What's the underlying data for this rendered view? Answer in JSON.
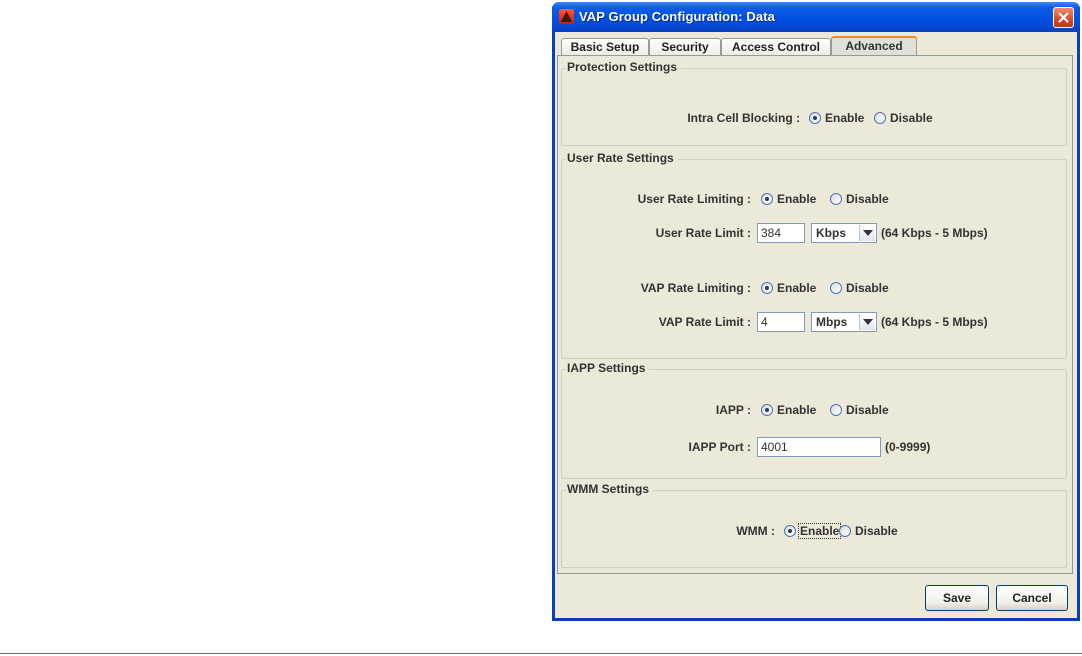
{
  "window": {
    "title": "VAP Group Configuration: Data"
  },
  "tabs": [
    {
      "label": "Basic Setup",
      "active": false
    },
    {
      "label": "Security",
      "active": false
    },
    {
      "label": "Access Control",
      "active": false
    },
    {
      "label": "Advanced",
      "active": true
    }
  ],
  "protection": {
    "title": "Protection Settings",
    "intra_cell_label": "Intra Cell Blocking :",
    "enable": "Enable",
    "disable": "Disable",
    "selected": "Enable"
  },
  "user_rate": {
    "title": "User Rate Settings",
    "user_limiting_label": "User Rate Limiting :",
    "user_limit_label": "User Rate Limit :",
    "user_limit_value": "384",
    "user_unit": "Kbps",
    "user_range": "(64 Kbps - 5 Mbps)",
    "vap_limiting_label": "VAP Rate Limiting :",
    "vap_limit_label": "VAP Rate Limit :",
    "vap_limit_value": "4",
    "vap_unit": "Mbps",
    "vap_range": "(64 Kbps - 5 Mbps)",
    "enable": "Enable",
    "disable": "Disable",
    "user_selected": "Enable",
    "vap_selected": "Enable"
  },
  "iapp": {
    "title": "IAPP Settings",
    "iapp_label": "IAPP :",
    "port_label": "IAPP Port :",
    "port_value": "4001",
    "port_range": "(0-9999)",
    "enable": "Enable",
    "disable": "Disable",
    "selected": "Enable"
  },
  "wmm": {
    "title": "WMM Settings",
    "wmm_label": "WMM :",
    "enable": "Enable",
    "disable": "Disable",
    "selected": "Enable"
  },
  "buttons": {
    "save": "Save",
    "cancel": "Cancel"
  },
  "colors": {
    "titlebar": "#0054e3",
    "panel": "#ece9d8",
    "active_tab_accent": "#e68b2c"
  }
}
